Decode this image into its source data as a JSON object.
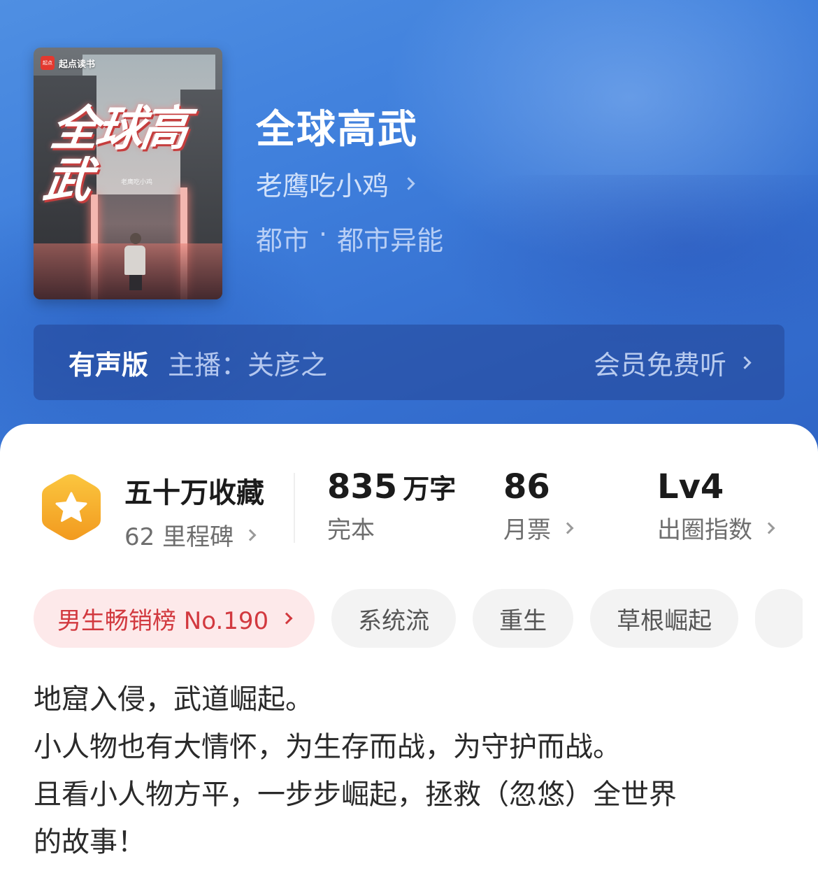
{
  "cover": {
    "brand_label": "起点读书",
    "badge_label": "起点",
    "cover_title": "全球高武",
    "cover_author": "老鹰吃小鸡"
  },
  "book": {
    "title": "全球高武",
    "author": "老鹰吃小鸡",
    "genre": "都市",
    "separator": "·",
    "subgenre": "都市异能"
  },
  "audio": {
    "tag": "有声版",
    "narrator": "主播：关彦之",
    "action": "会员免费听"
  },
  "stats": {
    "collections": "五十万收藏",
    "milestones": "62 里程碑",
    "word_count_number": "835",
    "word_count_unit": "万字",
    "status": "完本",
    "monthly_tickets": "86",
    "monthly_tickets_label": "月票",
    "level": "Lv4",
    "level_label": "出圈指数"
  },
  "tags": {
    "rank": "男生畅销榜 No.190",
    "items": [
      "系统流",
      "重生",
      "草根崛起",
      ""
    ]
  },
  "description": [
    "地窟入侵，武道崛起。",
    "小人物也有大情怀，为生存而战，为守护而战。",
    "且看小人物方平，一步步崛起，拯救（忽悠）全世界",
    "的故事！"
  ],
  "colors": {
    "hero_blue": "#3f7fdc",
    "rank_red": "#d2393f",
    "badge_orange": "#f4a623"
  }
}
